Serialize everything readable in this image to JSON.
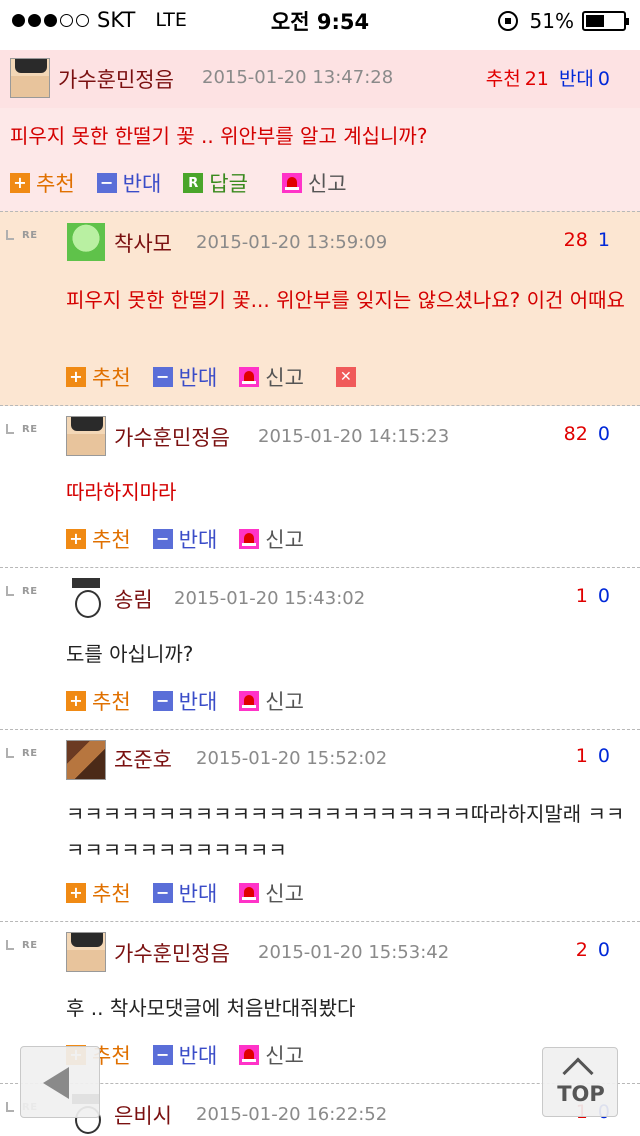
{
  "status_bar": {
    "carrier": "SKT",
    "network": "LTE",
    "time": "오전 9:54",
    "battery": "51%",
    "battery_level": 0.51,
    "signal_bars_filled": 3,
    "signal_bars_total": 5
  },
  "actions": {
    "recommend": "추천",
    "oppose": "반대",
    "reply": "답글",
    "report": "신고"
  },
  "labels": {
    "re": "RE",
    "recommend": "추천",
    "oppose": "반대",
    "delete": "✕",
    "reply_icon": "R",
    "plus_icon": "+",
    "minus_icon": "−"
  },
  "comments": [
    {
      "nickname": "가수훈민정음",
      "date": "2015-01-20 13:47:28",
      "up": "21",
      "down": "0",
      "text": "피우지 못한 한떨기 꽃 .. 위안부를 알고 계십니까?",
      "avatar": "face-avatar"
    },
    {
      "nickname": "착사모",
      "date": "2015-01-20 13:59:09",
      "up": "28",
      "down": "1",
      "text": "피우지 못한 한떨기 꽃... 위안부를 잊지는 않으셨나요? 이건 어때요",
      "avatar": "anime-avatar"
    },
    {
      "nickname": "가수훈민정음",
      "date": "2015-01-20 14:15:23",
      "up": "82",
      "down": "0",
      "text": "따라하지마라",
      "avatar": "face-avatar"
    },
    {
      "nickname": "송림",
      "date": "2015-01-20 15:43:02",
      "up": "1",
      "down": "0",
      "text": "도를 아십니까?",
      "avatar": "cartoon-avatar"
    },
    {
      "nickname": "조준호",
      "date": "2015-01-20 15:52:02",
      "up": "1",
      "down": "0",
      "text": "ㅋㅋㅋㅋㅋㅋㅋㅋㅋㅋㅋㅋㅋㅋㅋㅋㅋㅋㅋㅋㅋㅋ따라하지말래 ㅋㅋㅋㅋㅋㅋㅋㅋㅋㅋㅋㅋㅋㅋ",
      "avatar": "photo-avatar"
    },
    {
      "nickname": "가수훈민정음",
      "date": "2015-01-20 15:53:42",
      "up": "2",
      "down": "0",
      "text": "후 .. 착사모댓글에 처음반대줘봤다",
      "avatar": "face-avatar"
    },
    {
      "nickname": "은비시",
      "date": "2015-01-20 16:22:52",
      "up": "1",
      "down": "0",
      "text": "",
      "avatar": "cartoon-avatar"
    }
  ],
  "floating": {
    "back_icon": "back-arrow-icon",
    "top_label": "TOP"
  },
  "colors": {
    "top_comment_bg": "#fde8e8",
    "highlight_comment_bg": "#fce6d2",
    "nickname": "#7a1010",
    "up_vote": "#e00000",
    "down_vote": "#0028d8",
    "recommend": "#f08a14",
    "oppose": "#5a6ed8",
    "reply": "#4aa52a",
    "report": "#ff33c8"
  }
}
